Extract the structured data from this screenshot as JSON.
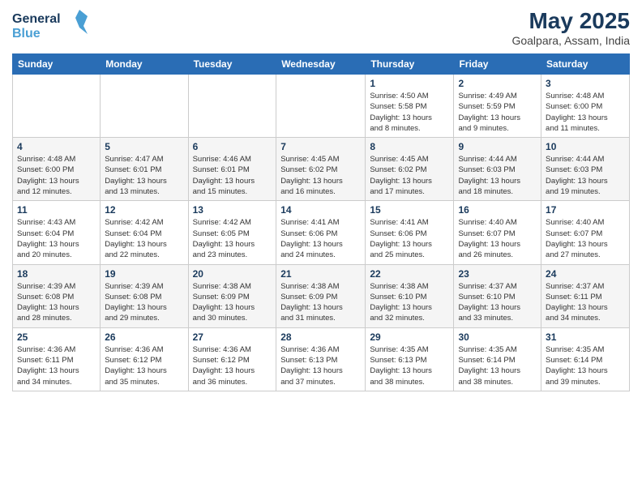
{
  "header": {
    "logo_line1": "General",
    "logo_line2": "Blue",
    "title": "May 2025",
    "subtitle": "Goalpara, Assam, India"
  },
  "weekdays": [
    "Sunday",
    "Monday",
    "Tuesday",
    "Wednesday",
    "Thursday",
    "Friday",
    "Saturday"
  ],
  "weeks": [
    [
      {
        "day": "",
        "info": ""
      },
      {
        "day": "",
        "info": ""
      },
      {
        "day": "",
        "info": ""
      },
      {
        "day": "",
        "info": ""
      },
      {
        "day": "1",
        "info": "Sunrise: 4:50 AM\nSunset: 5:58 PM\nDaylight: 13 hours\nand 8 minutes."
      },
      {
        "day": "2",
        "info": "Sunrise: 4:49 AM\nSunset: 5:59 PM\nDaylight: 13 hours\nand 9 minutes."
      },
      {
        "day": "3",
        "info": "Sunrise: 4:48 AM\nSunset: 6:00 PM\nDaylight: 13 hours\nand 11 minutes."
      }
    ],
    [
      {
        "day": "4",
        "info": "Sunrise: 4:48 AM\nSunset: 6:00 PM\nDaylight: 13 hours\nand 12 minutes."
      },
      {
        "day": "5",
        "info": "Sunrise: 4:47 AM\nSunset: 6:01 PM\nDaylight: 13 hours\nand 13 minutes."
      },
      {
        "day": "6",
        "info": "Sunrise: 4:46 AM\nSunset: 6:01 PM\nDaylight: 13 hours\nand 15 minutes."
      },
      {
        "day": "7",
        "info": "Sunrise: 4:45 AM\nSunset: 6:02 PM\nDaylight: 13 hours\nand 16 minutes."
      },
      {
        "day": "8",
        "info": "Sunrise: 4:45 AM\nSunset: 6:02 PM\nDaylight: 13 hours\nand 17 minutes."
      },
      {
        "day": "9",
        "info": "Sunrise: 4:44 AM\nSunset: 6:03 PM\nDaylight: 13 hours\nand 18 minutes."
      },
      {
        "day": "10",
        "info": "Sunrise: 4:44 AM\nSunset: 6:03 PM\nDaylight: 13 hours\nand 19 minutes."
      }
    ],
    [
      {
        "day": "11",
        "info": "Sunrise: 4:43 AM\nSunset: 6:04 PM\nDaylight: 13 hours\nand 20 minutes."
      },
      {
        "day": "12",
        "info": "Sunrise: 4:42 AM\nSunset: 6:04 PM\nDaylight: 13 hours\nand 22 minutes."
      },
      {
        "day": "13",
        "info": "Sunrise: 4:42 AM\nSunset: 6:05 PM\nDaylight: 13 hours\nand 23 minutes."
      },
      {
        "day": "14",
        "info": "Sunrise: 4:41 AM\nSunset: 6:06 PM\nDaylight: 13 hours\nand 24 minutes."
      },
      {
        "day": "15",
        "info": "Sunrise: 4:41 AM\nSunset: 6:06 PM\nDaylight: 13 hours\nand 25 minutes."
      },
      {
        "day": "16",
        "info": "Sunrise: 4:40 AM\nSunset: 6:07 PM\nDaylight: 13 hours\nand 26 minutes."
      },
      {
        "day": "17",
        "info": "Sunrise: 4:40 AM\nSunset: 6:07 PM\nDaylight: 13 hours\nand 27 minutes."
      }
    ],
    [
      {
        "day": "18",
        "info": "Sunrise: 4:39 AM\nSunset: 6:08 PM\nDaylight: 13 hours\nand 28 minutes."
      },
      {
        "day": "19",
        "info": "Sunrise: 4:39 AM\nSunset: 6:08 PM\nDaylight: 13 hours\nand 29 minutes."
      },
      {
        "day": "20",
        "info": "Sunrise: 4:38 AM\nSunset: 6:09 PM\nDaylight: 13 hours\nand 30 minutes."
      },
      {
        "day": "21",
        "info": "Sunrise: 4:38 AM\nSunset: 6:09 PM\nDaylight: 13 hours\nand 31 minutes."
      },
      {
        "day": "22",
        "info": "Sunrise: 4:38 AM\nSunset: 6:10 PM\nDaylight: 13 hours\nand 32 minutes."
      },
      {
        "day": "23",
        "info": "Sunrise: 4:37 AM\nSunset: 6:10 PM\nDaylight: 13 hours\nand 33 minutes."
      },
      {
        "day": "24",
        "info": "Sunrise: 4:37 AM\nSunset: 6:11 PM\nDaylight: 13 hours\nand 34 minutes."
      }
    ],
    [
      {
        "day": "25",
        "info": "Sunrise: 4:36 AM\nSunset: 6:11 PM\nDaylight: 13 hours\nand 34 minutes."
      },
      {
        "day": "26",
        "info": "Sunrise: 4:36 AM\nSunset: 6:12 PM\nDaylight: 13 hours\nand 35 minutes."
      },
      {
        "day": "27",
        "info": "Sunrise: 4:36 AM\nSunset: 6:12 PM\nDaylight: 13 hours\nand 36 minutes."
      },
      {
        "day": "28",
        "info": "Sunrise: 4:36 AM\nSunset: 6:13 PM\nDaylight: 13 hours\nand 37 minutes."
      },
      {
        "day": "29",
        "info": "Sunrise: 4:35 AM\nSunset: 6:13 PM\nDaylight: 13 hours\nand 38 minutes."
      },
      {
        "day": "30",
        "info": "Sunrise: 4:35 AM\nSunset: 6:14 PM\nDaylight: 13 hours\nand 38 minutes."
      },
      {
        "day": "31",
        "info": "Sunrise: 4:35 AM\nSunset: 6:14 PM\nDaylight: 13 hours\nand 39 minutes."
      }
    ]
  ]
}
